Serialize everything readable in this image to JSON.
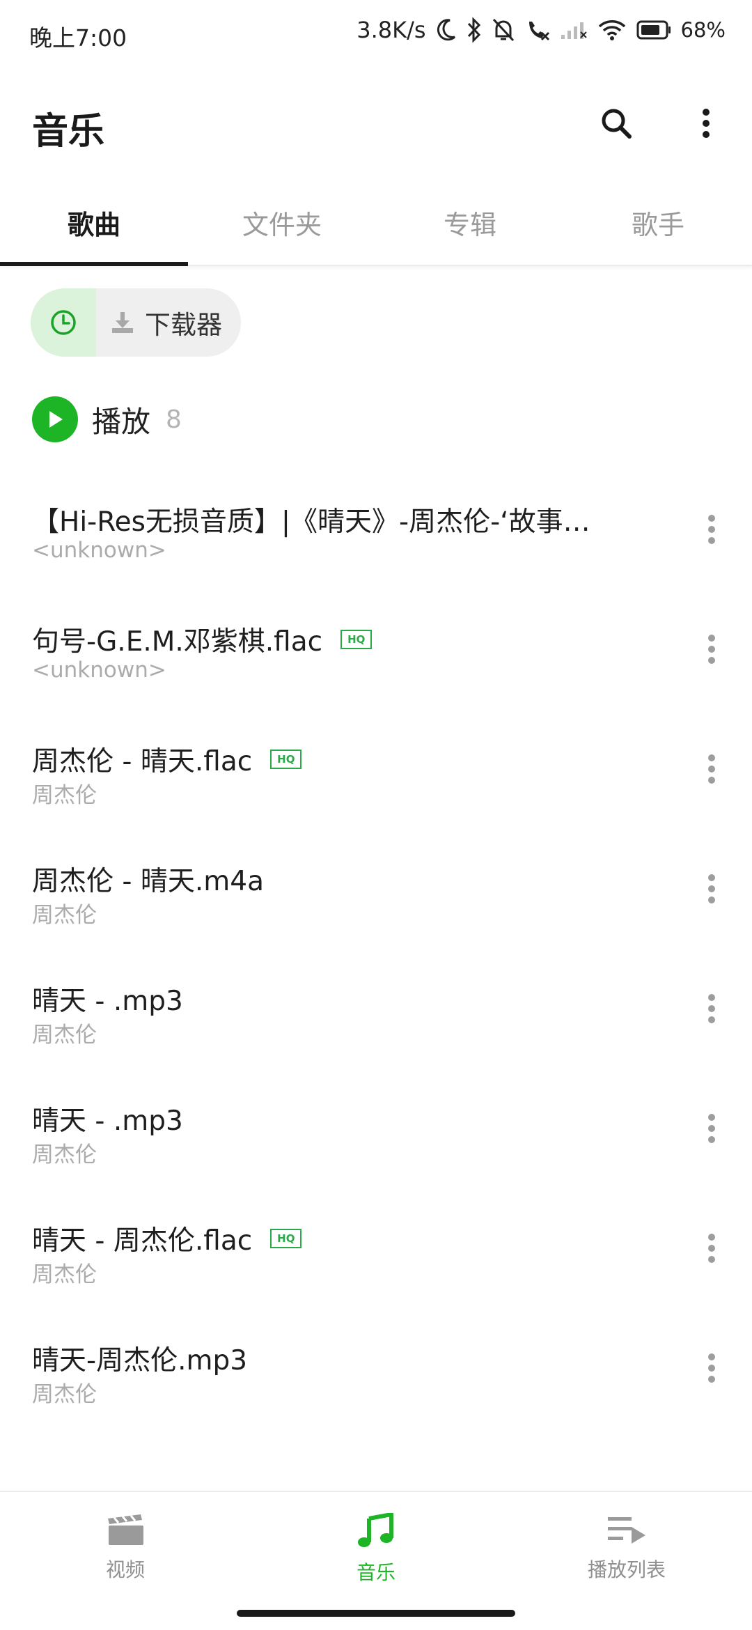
{
  "status_bar": {
    "time": "晚上7:00",
    "speed": "3.8K/s",
    "battery": "68%"
  },
  "app_bar": {
    "title": "音乐"
  },
  "tabs": [
    {
      "label": "歌曲",
      "active": true
    },
    {
      "label": "文件夹",
      "active": false
    },
    {
      "label": "专辑",
      "active": false
    },
    {
      "label": "歌手",
      "active": false
    }
  ],
  "chips": {
    "downloader_label": "下载器"
  },
  "play_all": {
    "label": "播放",
    "count": "8"
  },
  "songs": [
    {
      "title": "【Hi-Res无损音质】|《晴天》-周杰伦-‘故事的小黄花’",
      "artist": "<unknown>",
      "hq": false
    },
    {
      "title": "句号-G.E.M.邓紫棋.flac",
      "artist": "<unknown>",
      "hq": true
    },
    {
      "title": "周杰伦 - 晴天.flac",
      "artist": "周杰伦",
      "hq": true
    },
    {
      "title": "周杰伦 - 晴天.m4a",
      "artist": "周杰伦",
      "hq": false
    },
    {
      "title": "晴天 - .mp3",
      "artist": "周杰伦",
      "hq": false
    },
    {
      "title": "晴天 - .mp3",
      "artist": "周杰伦",
      "hq": false
    },
    {
      "title": "晴天 - 周杰伦.flac",
      "artist": "周杰伦",
      "hq": true
    },
    {
      "title": "晴天-周杰伦.mp3",
      "artist": "周杰伦",
      "hq": false
    }
  ],
  "hq_badge": "HQ",
  "bottom_nav": [
    {
      "label": "视频",
      "icon": "video-clapper-icon",
      "active": false
    },
    {
      "label": "音乐",
      "icon": "music-note-icon",
      "active": true
    },
    {
      "label": "播放列表",
      "icon": "playlist-icon",
      "active": false
    }
  ],
  "colors": {
    "accent": "#1db526",
    "hq": "#2aa84a",
    "history_chip": "#dbf3da"
  }
}
